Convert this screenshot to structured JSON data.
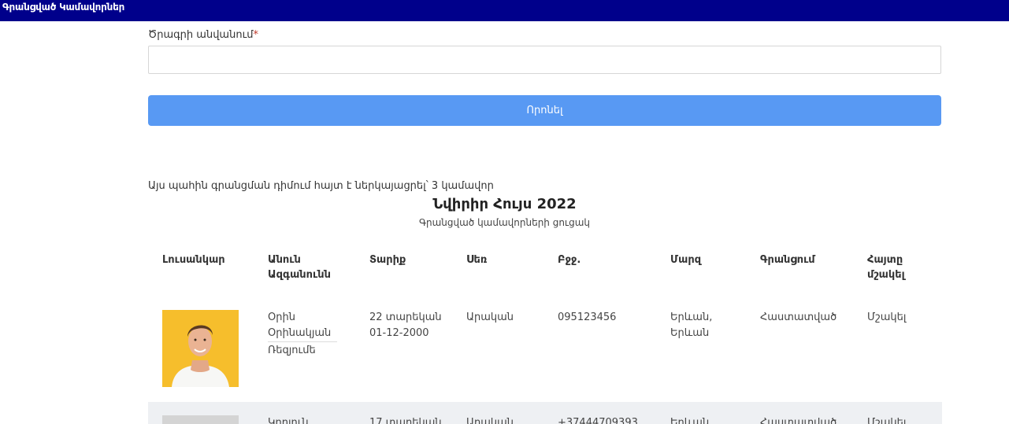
{
  "header": {
    "title": "Գրանցված Կամավորներ"
  },
  "form": {
    "label": "Ծրագրի անվանում",
    "required_mark": "*",
    "input_value": "",
    "search_label": "Որոնել"
  },
  "results": {
    "note": "Այս պահին գրանցման դիմում հայտ է ներկայացրել՝ 3 կամավոր",
    "title": "Նվիրիր Հույս 2022",
    "subtitle": "Գրանցված կամավորների ցուցակ"
  },
  "table": {
    "headers": {
      "photo": "Լուսանկար",
      "name_line1": "Անուն",
      "name_line2": "Ազգանունն",
      "age": "Տարիք",
      "gender": "Սեռ",
      "phone": "Բջջ.",
      "region": "Մարզ",
      "registration": "Գրանցում",
      "action_line1": "Հայտը",
      "action_line2": "մշակել"
    },
    "rows": [
      {
        "first_name": "Օրին",
        "last_name": "Օրինակյան",
        "status": "Ռեզյումե",
        "age": "22 տարեկան",
        "birthdate": "01-12-2000",
        "gender": "Արական",
        "phone": "095123456",
        "region_line1": "Երևան,",
        "region_line2": "Երևան",
        "registration": "Հաստատված",
        "action": "Մշակել"
      },
      {
        "first_name": "Կորյուն",
        "age": "17 տարեկան",
        "gender": "Արական",
        "phone": "+37444709393",
        "region_line1": "Երևան",
        "registration": "Հաստատված",
        "action": "Մշակել"
      }
    ]
  },
  "colors": {
    "topbar": "#00008b",
    "button": "#5899f3",
    "photo_bg": "#f6be2c",
    "row_alt": "#eef0f3"
  }
}
